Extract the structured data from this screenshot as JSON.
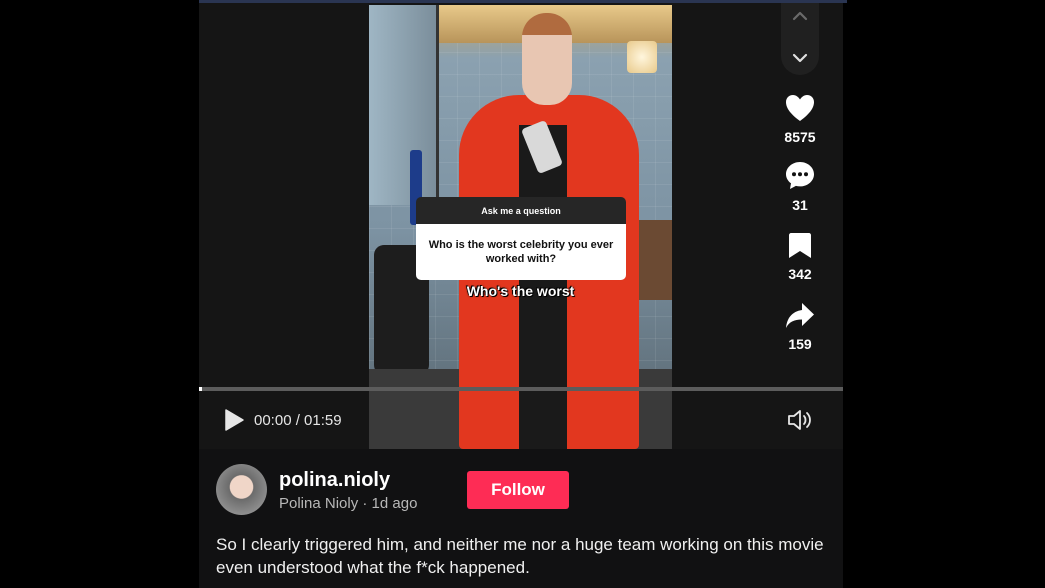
{
  "video": {
    "question_header": "Ask me a question",
    "question_text": "Who is the worst celebrity you ever worked with?",
    "caption": "Who's the worst"
  },
  "navigation": {
    "up_icon": "chevron-up-icon",
    "down_icon": "chevron-down-icon"
  },
  "actions": {
    "likes": "8575",
    "comments": "31",
    "saves": "342",
    "shares": "159"
  },
  "player": {
    "time": "00:00 / 01:59",
    "progress_fraction": 0.005
  },
  "author": {
    "username": "polina.nioly",
    "display_line": "Polina Nioly · 1d ago",
    "follow_label": "Follow"
  },
  "description": "So I clearly triggered him, and neither me nor a huge team working on this movie even understood what the f*ck happened.",
  "colors": {
    "follow_button": "#fe2c55",
    "background": "#111112"
  }
}
